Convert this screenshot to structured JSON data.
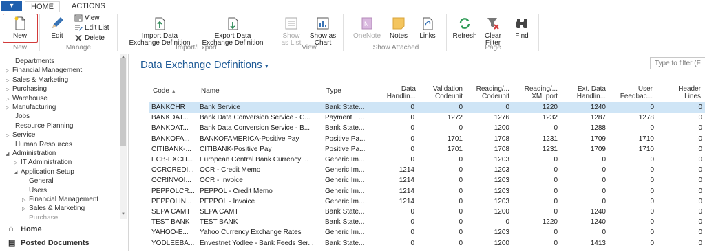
{
  "tabs": {
    "home": "HOME",
    "actions": "ACTIONS"
  },
  "ribbon": {
    "new": "New",
    "edit": "Edit",
    "view": "View",
    "edit_list": "Edit List",
    "delete": "Delete",
    "import_1": "Import Data",
    "import_2": "Exchange Definition",
    "export_1": "Export Data",
    "export_2": "Exchange Definition",
    "show_list_1": "Show",
    "show_list_2": "as List",
    "show_chart_1": "Show as",
    "show_chart_2": "Chart",
    "onenote": "OneNote",
    "notes": "Notes",
    "links": "Links",
    "refresh": "Refresh",
    "clear_1": "Clear",
    "clear_2": "Filter",
    "find": "Find",
    "groups": {
      "new": "New",
      "manage": "Manage",
      "import_export": "Import/Export",
      "view": "View",
      "show_attached": "Show Attached",
      "page": "Page"
    }
  },
  "nav": {
    "items": [
      "Departments",
      "Financial Management",
      "Sales & Marketing",
      "Purchasing",
      "Warehouse",
      "Manufacturing",
      "Jobs",
      "Resource Planning",
      "Service",
      "Human Resources",
      "Administration",
      "IT Administration",
      "Application Setup",
      "General",
      "Users",
      "Financial Management",
      "Sales & Marketing",
      "Purchase"
    ],
    "home": "Home",
    "posted": "Posted Documents"
  },
  "main": {
    "title": "Data Exchange Definitions",
    "filter_placeholder": "Type to filter (F",
    "headers": {
      "code": "Code",
      "name": "Name",
      "type": "Type",
      "data_h1": "Data",
      "data_h2": "Handlin...",
      "val_1": "Validation",
      "val_2": "Codeunit",
      "rd_1": "Reading/...",
      "rd_2": "Codeunit",
      "rx_1": "Reading/...",
      "rx_2": "XMLport",
      "ext_1": "Ext. Data",
      "ext_2": "Handlin...",
      "user_1": "User",
      "user_2": "Feedbac...",
      "hl_1": "Header",
      "hl_2": "Lines"
    },
    "rows": [
      {
        "code": "BANKCHR",
        "name": "Bank Service",
        "type": "Bank State...",
        "d": "0",
        "v": "0",
        "rc": "0",
        "rx": "1220",
        "ext": "1240",
        "uf": "0",
        "hl": "0"
      },
      {
        "code": "BANKDAT...",
        "name": "Bank Data Conversion Service - C...",
        "type": "Payment E...",
        "d": "0",
        "v": "1272",
        "rc": "1276",
        "rx": "1232",
        "ext": "1287",
        "uf": "1278",
        "hl": "0"
      },
      {
        "code": "BANKDAT...",
        "name": "Bank Data Conversion Service - B...",
        "type": "Bank State...",
        "d": "0",
        "v": "0",
        "rc": "1200",
        "rx": "0",
        "ext": "1288",
        "uf": "0",
        "hl": "0"
      },
      {
        "code": "BANKOFA...",
        "name": "BANKOFAMERICA-Positive Pay",
        "type": "Positive Pa...",
        "d": "0",
        "v": "1701",
        "rc": "1708",
        "rx": "1231",
        "ext": "1709",
        "uf": "1710",
        "hl": "0"
      },
      {
        "code": "CITIBANK-...",
        "name": "CITIBANK-Positive Pay",
        "type": "Positive Pa...",
        "d": "0",
        "v": "1701",
        "rc": "1708",
        "rx": "1231",
        "ext": "1709",
        "uf": "1710",
        "hl": "0"
      },
      {
        "code": "ECB-EXCH...",
        "name": "European Central Bank Currency ...",
        "type": "Generic Im...",
        "d": "0",
        "v": "0",
        "rc": "1203",
        "rx": "0",
        "ext": "0",
        "uf": "0",
        "hl": "0"
      },
      {
        "code": "OCRCREDI...",
        "name": "OCR - Credit Memo",
        "type": "Generic Im...",
        "d": "1214",
        "v": "0",
        "rc": "1203",
        "rx": "0",
        "ext": "0",
        "uf": "0",
        "hl": "0"
      },
      {
        "code": "OCRINVOI...",
        "name": "OCR - Invoice",
        "type": "Generic Im...",
        "d": "1214",
        "v": "0",
        "rc": "1203",
        "rx": "0",
        "ext": "0",
        "uf": "0",
        "hl": "0"
      },
      {
        "code": "PEPPOLCR...",
        "name": "PEPPOL - Credit Memo",
        "type": "Generic Im...",
        "d": "1214",
        "v": "0",
        "rc": "1203",
        "rx": "0",
        "ext": "0",
        "uf": "0",
        "hl": "0"
      },
      {
        "code": "PEPPOLIN...",
        "name": "PEPPOL - Invoice",
        "type": "Generic Im...",
        "d": "1214",
        "v": "0",
        "rc": "1203",
        "rx": "0",
        "ext": "0",
        "uf": "0",
        "hl": "0"
      },
      {
        "code": "SEPA CAMT",
        "name": "SEPA CAMT",
        "type": "Bank State...",
        "d": "0",
        "v": "0",
        "rc": "1200",
        "rx": "0",
        "ext": "1240",
        "uf": "0",
        "hl": "0"
      },
      {
        "code": "TEST BANK",
        "name": "TEST BANK",
        "type": "Bank State...",
        "d": "0",
        "v": "0",
        "rc": "0",
        "rx": "1220",
        "ext": "1240",
        "uf": "0",
        "hl": "0"
      },
      {
        "code": "YAHOO-E...",
        "name": "Yahoo Currency Exchange Rates",
        "type": "Generic Im...",
        "d": "0",
        "v": "0",
        "rc": "1203",
        "rx": "0",
        "ext": "0",
        "uf": "0",
        "hl": "0"
      },
      {
        "code": "YODLEEBA...",
        "name": "Envestnet Yodlee - Bank Feeds Ser...",
        "type": "Bank State...",
        "d": "0",
        "v": "0",
        "rc": "1200",
        "rx": "0",
        "ext": "1413",
        "uf": "0",
        "hl": "0"
      }
    ]
  },
  "colors": {
    "accent": "#1e5a96",
    "selection": "#cfe5f6",
    "app_button": "#1f5fae",
    "highlight": "#d23a3a"
  }
}
